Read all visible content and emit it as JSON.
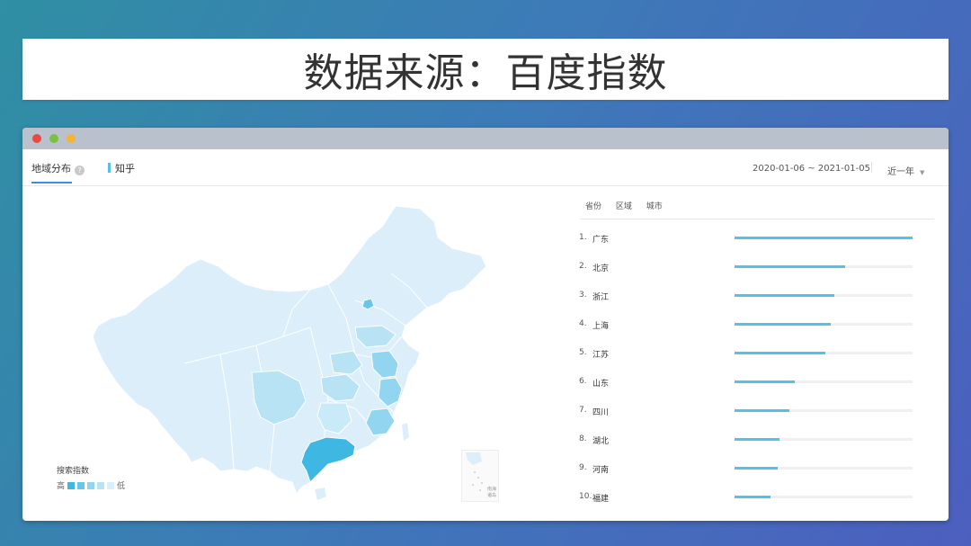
{
  "banner": {
    "title": "数据来源：百度指数"
  },
  "tabs": {
    "region": "地域分布",
    "keyword": "知乎"
  },
  "filters": {
    "date_range": "2020-01-06 ~ 2021-01-05",
    "period": "近一年"
  },
  "sub_tabs": [
    "省份",
    "区域",
    "城市"
  ],
  "legend": {
    "title": "搜索指数",
    "high": "高",
    "low": "低",
    "colors": [
      "#3fb7e3",
      "#68c6ea",
      "#91d5f0",
      "#b7e3f5",
      "#d9eff9"
    ]
  },
  "inset": {
    "label_line1": "南海",
    "label_line2": "诸岛"
  },
  "colors": {
    "accent": "#4ec4e8",
    "tab_underline": "#3a8ee6",
    "map_base": "#dbeef9"
  },
  "chart_data": {
    "type": "bar",
    "categories": [
      "广东",
      "北京",
      "浙江",
      "上海",
      "江苏",
      "山东",
      "四川",
      "湖北",
      "河南",
      "福建"
    ],
    "values": [
      100,
      62,
      56,
      54,
      51,
      34,
      31,
      25,
      24,
      20
    ],
    "ranks": [
      "1.",
      "2.",
      "3.",
      "4.",
      "5.",
      "6.",
      "7.",
      "8.",
      "9.",
      "10."
    ]
  }
}
